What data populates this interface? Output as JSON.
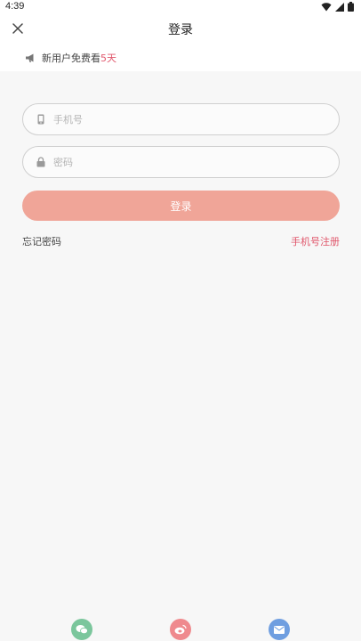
{
  "status_bar": {
    "time": "4:39"
  },
  "header": {
    "title": "登录",
    "close_icon": "close-icon"
  },
  "promo": {
    "text": "新用户免费看",
    "highlight": "5天",
    "icon": "megaphone-icon"
  },
  "form": {
    "phone_placeholder": "手机号",
    "phone_value": "",
    "password_placeholder": "密码",
    "password_value": "",
    "login_label": "登录"
  },
  "links": {
    "forgot": "忘记密码",
    "register": "手机号注册"
  },
  "social": [
    {
      "icon": "wechat-icon",
      "color": "#7bc69c"
    },
    {
      "icon": "weibo-icon",
      "color": "#ef8a8e"
    },
    {
      "icon": "mail-icon",
      "color": "#6f9ee0"
    }
  ],
  "colors": {
    "accent": "#e0566b",
    "login_button": "#f0a598",
    "background": "#f7f7f7"
  }
}
